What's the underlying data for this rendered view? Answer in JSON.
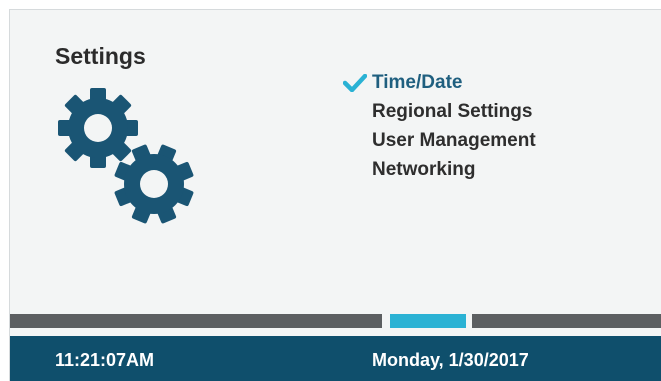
{
  "screen": {
    "title": "Settings",
    "icon": "gears-icon"
  },
  "menu": {
    "items": [
      {
        "label": "Time/Date",
        "selected": true
      },
      {
        "label": "Regional Settings",
        "selected": false
      },
      {
        "label": "User Management",
        "selected": false
      },
      {
        "label": "Networking",
        "selected": false
      }
    ]
  },
  "pager": {
    "pages": 3,
    "current": 2
  },
  "statusbar": {
    "time": "11:21:07AM",
    "date": "Monday, 1/30/2017"
  },
  "colors": {
    "accent": "#2ab2d4",
    "statusbar": "#0f4f6c",
    "gear": "#1a5574",
    "selected_text": "#1f5f7f"
  }
}
